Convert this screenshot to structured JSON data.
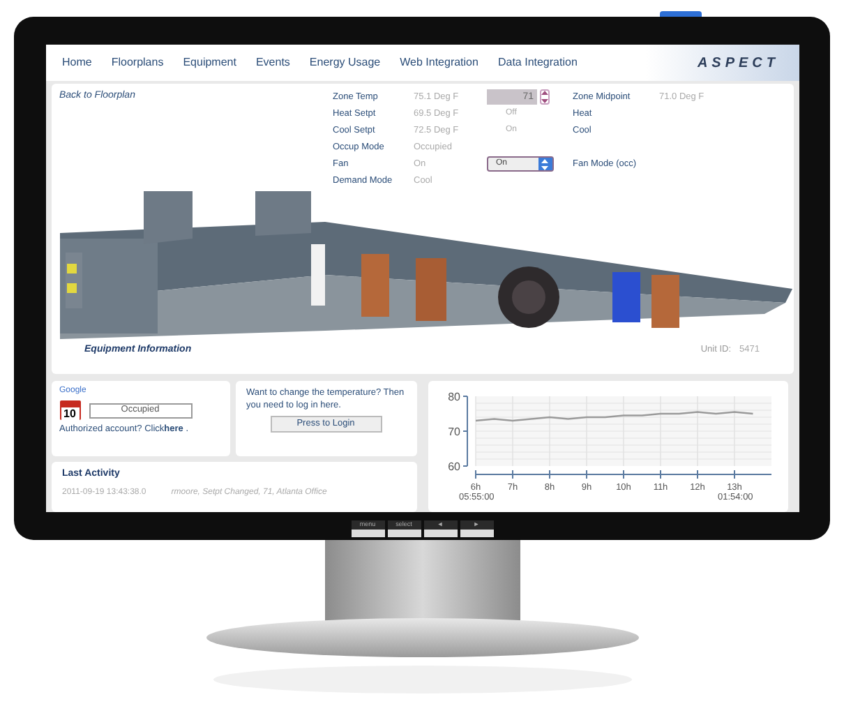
{
  "nav": {
    "items": [
      "Home",
      "Floorplans",
      "Equipment",
      "Events",
      "Energy Usage",
      "Web Integration",
      "Data Integration"
    ],
    "logo": "ASPECT"
  },
  "equipment": {
    "back_link": "Back to Floorplan",
    "rows": [
      {
        "label": "Zone Temp",
        "value": "75.1 Deg F",
        "control": {
          "kind": "spinner",
          "value": "71"
        },
        "label2": "Zone Midpoint",
        "value2": "71.0 Deg F"
      },
      {
        "label": "Heat Setpt",
        "value": "69.5 Deg F",
        "control": {
          "kind": "text",
          "value": "Off"
        },
        "label2": "Heat"
      },
      {
        "label": "Cool Setpt",
        "value": "72.5 Deg F",
        "control": {
          "kind": "text",
          "value": "On"
        },
        "label2": "Cool"
      },
      {
        "label": "Occup Mode",
        "value": "Occupied"
      },
      {
        "label": "Fan",
        "value": "On",
        "control": {
          "kind": "select",
          "value": "On"
        },
        "label2": "Fan Mode (occ)"
      },
      {
        "label": "Demand Mode",
        "value": "Cool"
      }
    ],
    "title": "Equipment Information",
    "unit_label": "Unit ID:",
    "unit_id": "5471"
  },
  "schedule": {
    "brand": "Google",
    "calendar_day": "10",
    "status": "Occupied",
    "auth_text": "Authorized account? Click**here** ."
  },
  "login": {
    "message": "Want to change the temperature? Then you need to log in here.",
    "button": "Press to Login"
  },
  "activity": {
    "title": "Last Activity",
    "time": "2011-09-19 13:43:38.0",
    "detail": "rmoore, Setpt Changed, 71, Atlanta Office"
  },
  "trend": {
    "start_time": "05:55:00",
    "end_time": "01:54:00",
    "chart_data": {
      "type": "line",
      "x": [
        6,
        6.5,
        7,
        7.5,
        8,
        8.5,
        9,
        9.5,
        10,
        10.5,
        11,
        11.5,
        12,
        12.5,
        13,
        13.5
      ],
      "xlim": [
        6,
        14
      ],
      "ylim": [
        60,
        80
      ],
      "yticks": [
        60,
        70,
        80
      ],
      "xticks": [
        {
          "value": 6,
          "label": "6h"
        },
        {
          "value": 7,
          "label": "7h"
        },
        {
          "value": 8,
          "label": "8h"
        },
        {
          "value": 9,
          "label": "9h"
        },
        {
          "value": 10,
          "label": "10h"
        },
        {
          "value": 11,
          "label": "11h"
        },
        {
          "value": 12,
          "label": "12h"
        },
        {
          "value": 13,
          "label": "13h"
        }
      ],
      "grid": true,
      "series": [
        {
          "color": "#9a9a9a",
          "values": [
            73,
            73.5,
            73,
            73.5,
            74,
            73.5,
            74,
            74,
            74.5,
            74.5,
            75,
            75,
            75.5,
            75,
            75.5,
            75
          ]
        }
      ]
    }
  },
  "monitor": {
    "buttons": [
      "menu",
      "select",
      "◄",
      "►"
    ]
  }
}
